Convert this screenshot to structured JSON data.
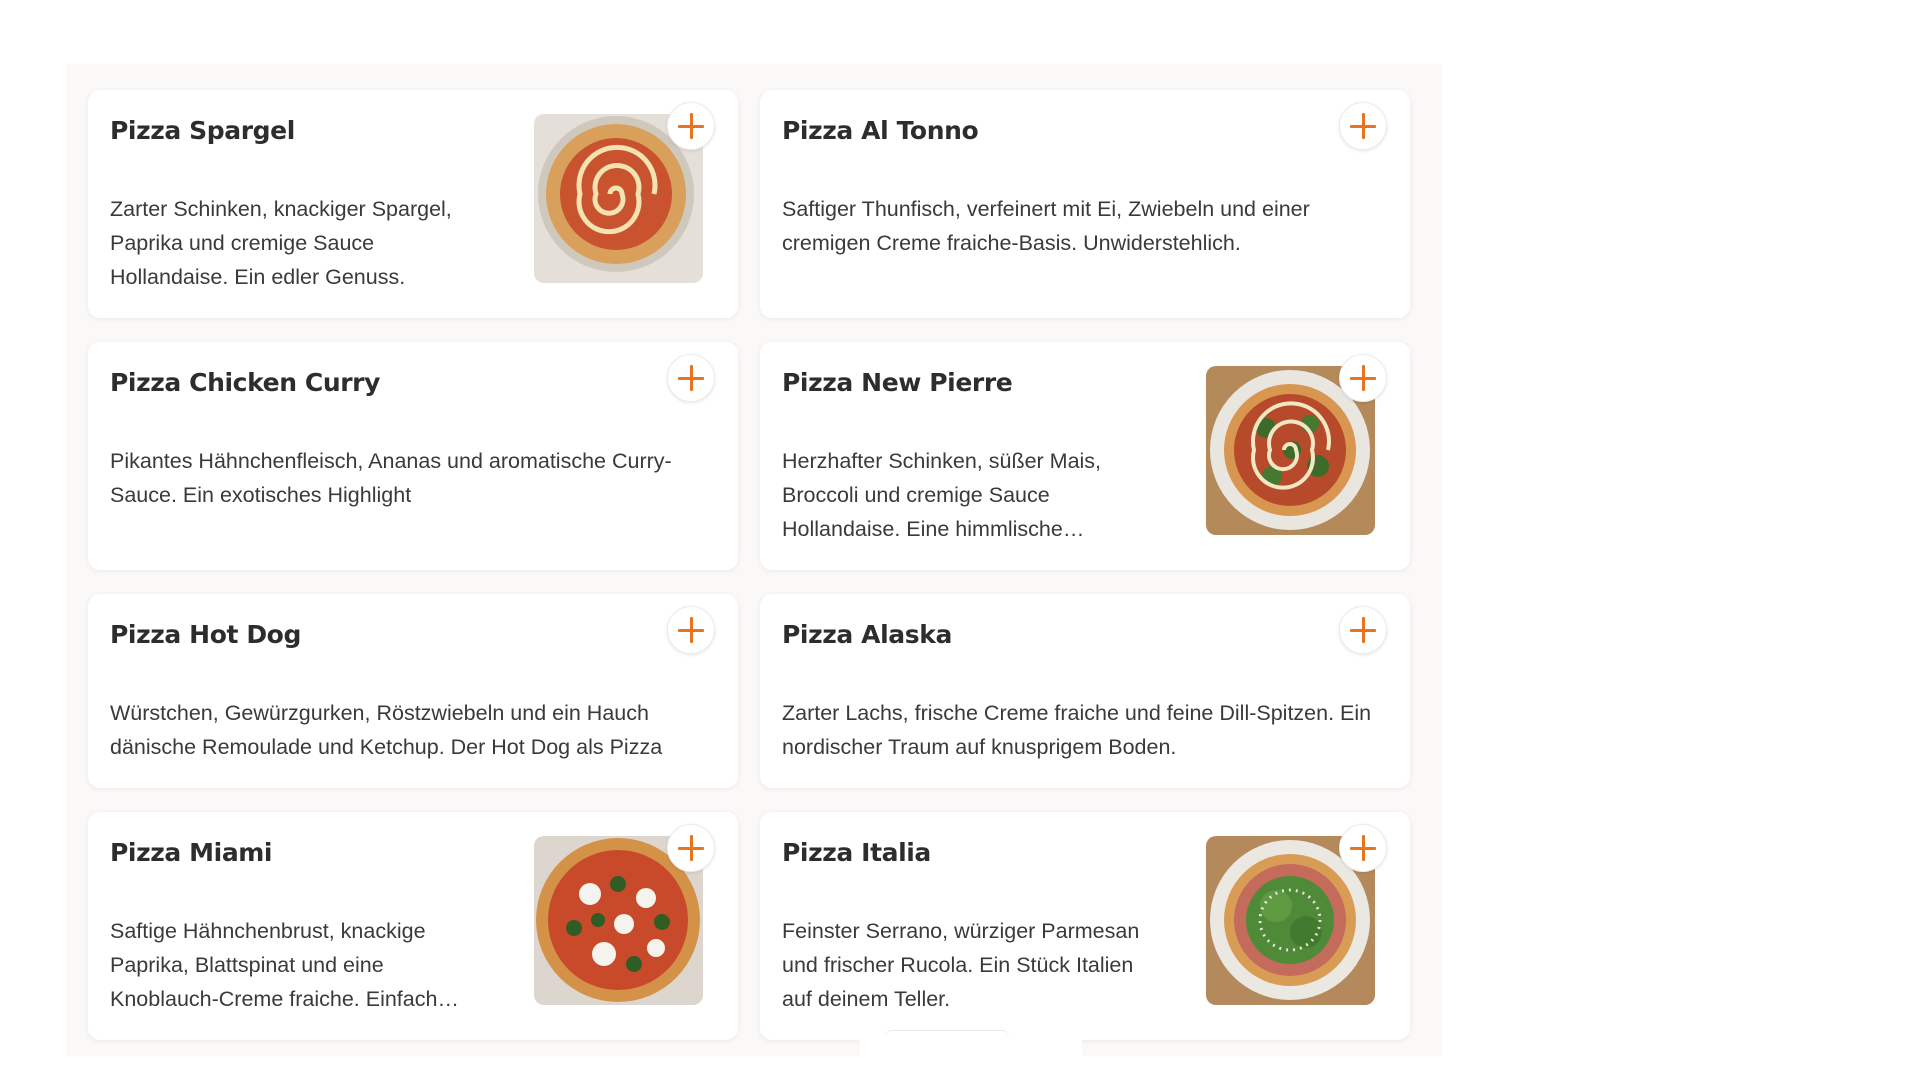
{
  "colors": {
    "accent": "#e8741e",
    "panel": "#fbf9f8",
    "card": "#ffffff"
  },
  "add_button": {
    "icon": "plus-icon"
  },
  "products": [
    {
      "name": "Pizza Spargel",
      "description": "Zarter Schinken, knackiger Spargel, Paprika und cremige Sauce Hollandaise. Ein edler Genuss.",
      "has_image": true
    },
    {
      "name": "Pizza Al Tonno",
      "description": "Saftiger Thunfisch, verfeinert mit Ei, Zwiebeln und einer cremigen Creme fraiche-Basis. Unwiderstehlich.",
      "has_image": false
    },
    {
      "name": "Pizza Chicken Curry",
      "description": "Pikantes Hähnchenfleisch, Ananas und aromatische Curry-Sauce. Ein exotisches Highlight",
      "has_image": false
    },
    {
      "name": "Pizza New Pierre",
      "description": "Herzhafter Schinken, süßer Mais, Broccoli und cremige Sauce Hollandaise. Eine himmlische…",
      "has_image": true
    },
    {
      "name": "Pizza Hot Dog",
      "description": "Würstchen, Gewürzgurken, Röstzwiebeln und ein Hauch dänische Remoulade und Ketchup. Der Hot Dog als Pizza",
      "has_image": false
    },
    {
      "name": "Pizza Alaska",
      "description": "Zarter Lachs, frische Creme fraiche und feine Dill-Spitzen. Ein nordischer Traum auf knusprigem Boden.",
      "has_image": false
    },
    {
      "name": "Pizza Miami",
      "description": "Saftige Hähnchenbrust, knackige Paprika, Blattspinat und eine Knoblauch-Creme fraiche. Einfach…",
      "has_image": true
    },
    {
      "name": "Pizza Italia",
      "description": "Feinster Serrano, würziger Parmesan und frischer Rucola. Ein Stück Italien auf deinem Teller.",
      "has_image": true
    }
  ]
}
